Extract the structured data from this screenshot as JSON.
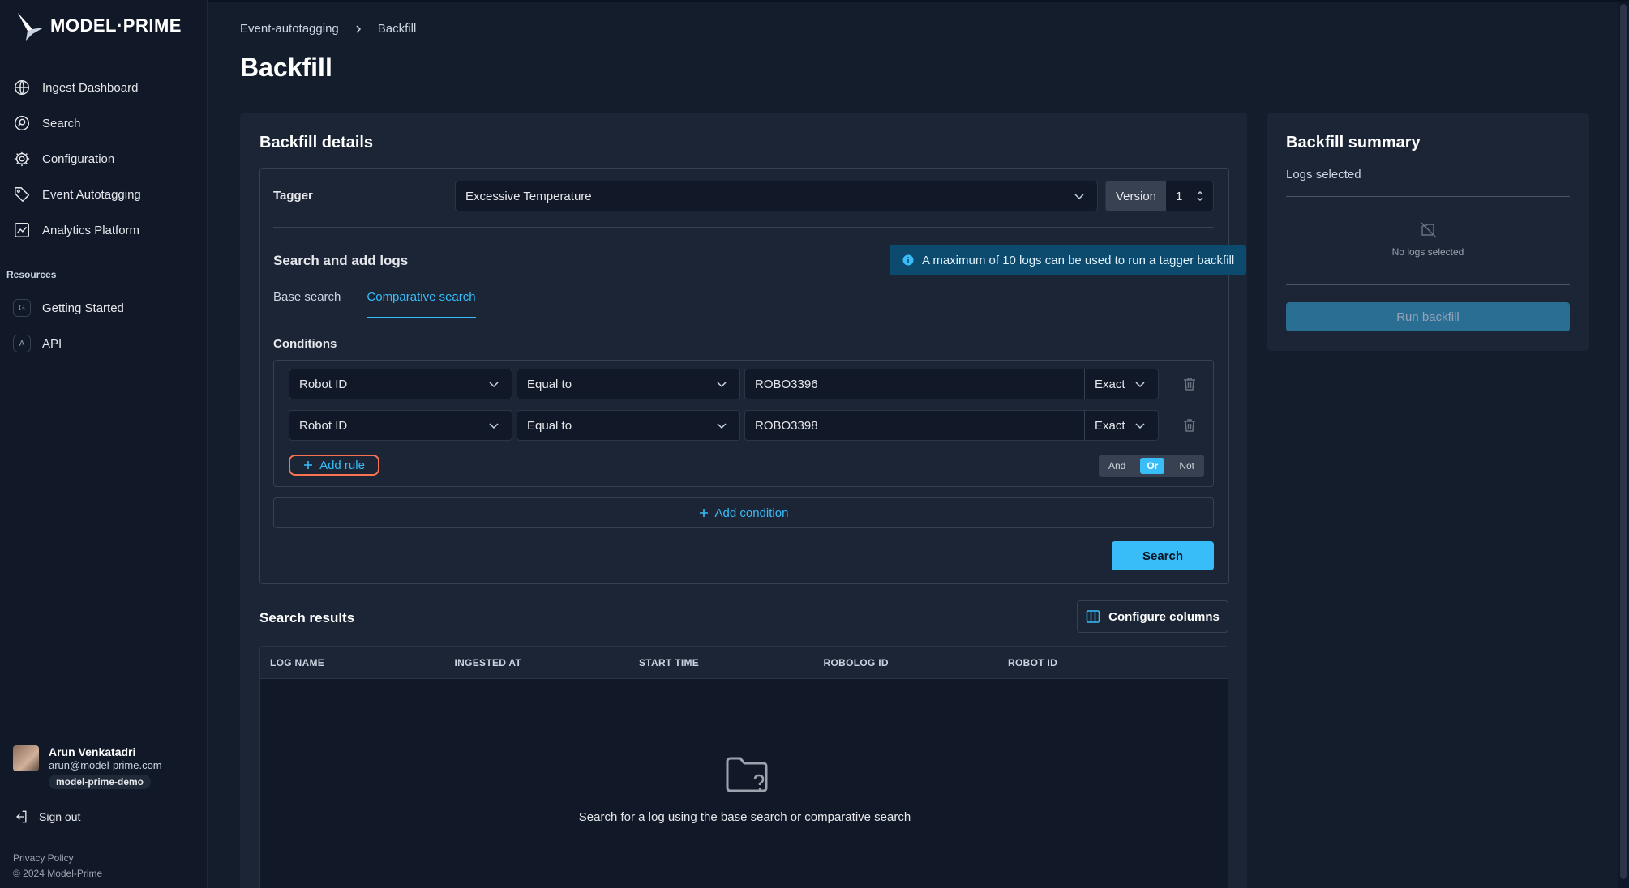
{
  "brand": {
    "name": "MODEL·PRIME"
  },
  "sidebar": {
    "nav": [
      {
        "label": "Ingest Dashboard",
        "icon": "globe-icon"
      },
      {
        "label": "Search",
        "icon": "search-icon"
      },
      {
        "label": "Configuration",
        "icon": "gear-icon"
      },
      {
        "label": "Event Autotagging",
        "icon": "tag-icon"
      },
      {
        "label": "Analytics Platform",
        "icon": "chart-icon"
      }
    ],
    "resources_title": "Resources",
    "resources": [
      {
        "badge": "G",
        "label": "Getting Started"
      },
      {
        "badge": "A",
        "label": "API"
      }
    ],
    "user": {
      "name": "Arun Venkatadri",
      "email": "arun@model-prime.com",
      "org": "model-prime-demo"
    },
    "signout": "Sign out",
    "privacy": "Privacy Policy",
    "copyright": "© 2024 Model-Prime"
  },
  "breadcrumb": {
    "parent": "Event-autotagging",
    "current": "Backfill"
  },
  "page": {
    "title": "Backfill"
  },
  "details": {
    "title": "Backfill details",
    "tagger_label": "Tagger",
    "tagger_value": "Excessive Temperature",
    "version_label": "Version",
    "version_value": "1",
    "search_title": "Search and add logs",
    "info": "A maximum of 10 logs can be used to run a tagger backfill",
    "tabs": [
      "Base search",
      "Comparative search"
    ],
    "active_tab": "Comparative search",
    "conditions_label": "Conditions",
    "rules": [
      {
        "field": "Robot ID",
        "operator": "Equal to",
        "value": "ROBO3396",
        "match": "Exact"
      },
      {
        "field": "Robot ID",
        "operator": "Equal to",
        "value": "ROBO3398",
        "match": "Exact"
      }
    ],
    "add_rule": "Add rule",
    "logic": [
      "And",
      "Or",
      "Not"
    ],
    "logic_active": "Or",
    "add_condition": "Add condition",
    "search_button": "Search"
  },
  "results": {
    "title": "Search results",
    "configure_columns": "Configure columns",
    "columns": [
      "LOG NAME",
      "INGESTED AT",
      "START TIME",
      "ROBOLOG ID",
      "ROBOT ID"
    ],
    "empty_text": "Search for a log using the base search or comparative search"
  },
  "summary": {
    "title": "Backfill summary",
    "logs_selected": "Logs selected",
    "no_logs": "No logs selected",
    "run_button": "Run backfill"
  },
  "colors": {
    "accent": "#38bdf8",
    "background": "#141d2b",
    "card": "#1b2536",
    "highlight": "#f97352"
  }
}
